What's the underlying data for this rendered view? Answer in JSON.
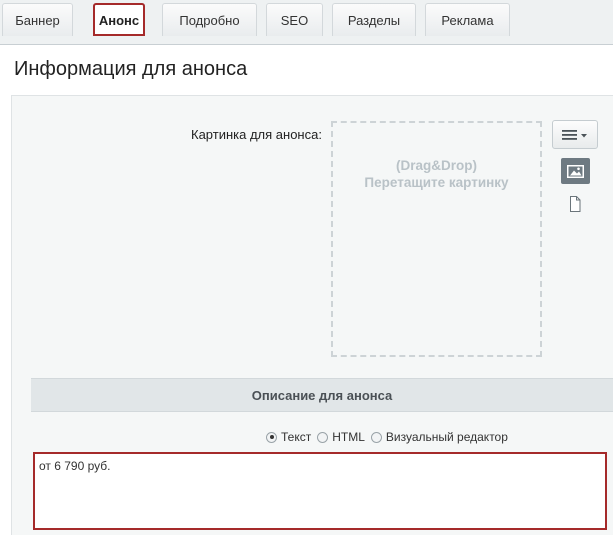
{
  "tabs": [
    {
      "label": "Баннер",
      "active": false
    },
    {
      "label": "Анонс",
      "active": true
    },
    {
      "label": "Подробно",
      "active": false
    },
    {
      "label": "SEO",
      "active": false
    },
    {
      "label": "Разделы",
      "active": false
    },
    {
      "label": "Реклама",
      "active": false
    }
  ],
  "page_title": "Информация для анонса",
  "image_field": {
    "label": "Картинка для анонса:",
    "dropzone_line1": "(Drag&Drop)",
    "dropzone_line2": "Перетащите картинку",
    "icons": [
      "menu-icon",
      "image-icon",
      "file-icon"
    ]
  },
  "description": {
    "section_title": "Описание для анонса",
    "modes": [
      "Текст",
      "HTML",
      "Визуальный редактор"
    ],
    "selected_mode": "Текст",
    "value": "от 6 790 руб."
  },
  "colors": {
    "highlight": "#a52a2a",
    "section_bar": "#e1e6e8",
    "panel": "#f5f7f7"
  }
}
